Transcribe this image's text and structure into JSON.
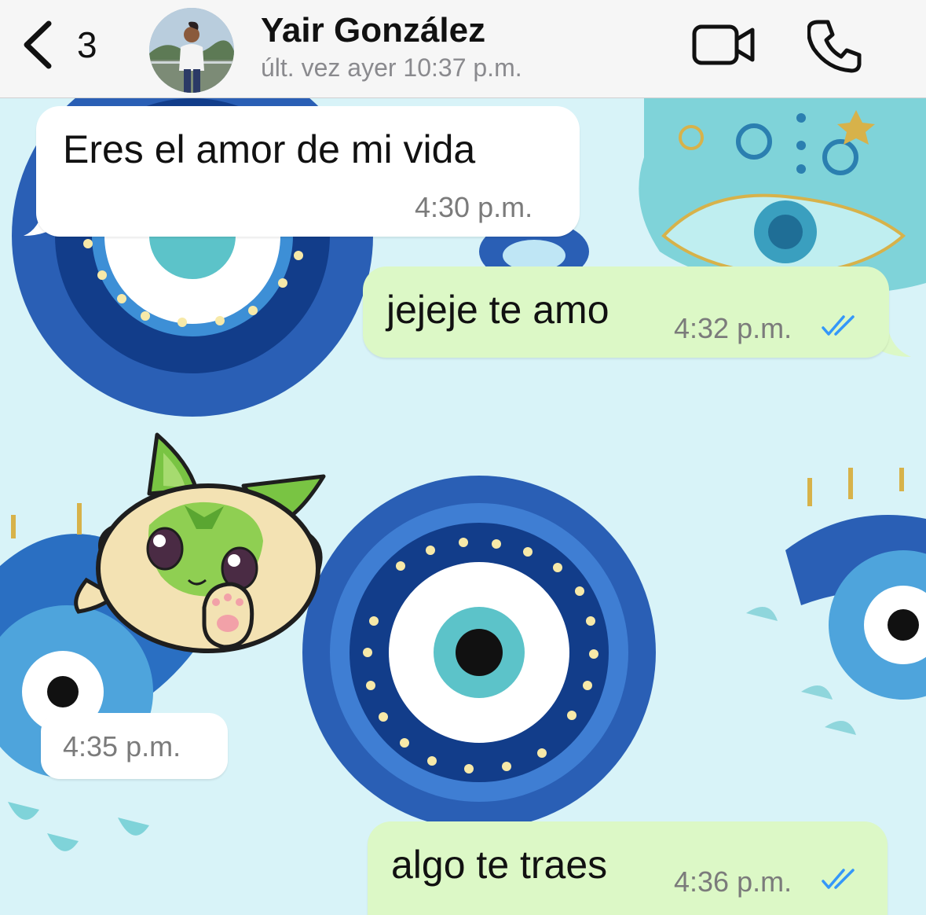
{
  "header": {
    "back_count": "3",
    "contact_name": "Yair González",
    "last_seen": "últ. vez ayer 10:37 p.m.",
    "icons": {
      "back": "chevron-left-icon",
      "video": "video-camera-icon",
      "call": "phone-icon"
    }
  },
  "messages": [
    {
      "direction": "in",
      "type": "text",
      "text": "Eres el amor de mi vida",
      "time": "4:30 p.m."
    },
    {
      "direction": "out",
      "type": "text",
      "text": "jejeje te amo",
      "time": "4:32 p.m.",
      "status": "read"
    },
    {
      "direction": "in",
      "type": "sticker",
      "sticker": "green cat sticker",
      "time": "4:35 p.m."
    },
    {
      "direction": "out",
      "type": "text",
      "text": "algo te traes",
      "time": "4:36 p.m.",
      "status": "read"
    }
  ],
  "colors": {
    "incoming_bubble": "#ffffff",
    "outgoing_bubble": "#dcf8c6",
    "read_ticks": "#3497f9",
    "wallpaper": "#d8f3f8"
  }
}
